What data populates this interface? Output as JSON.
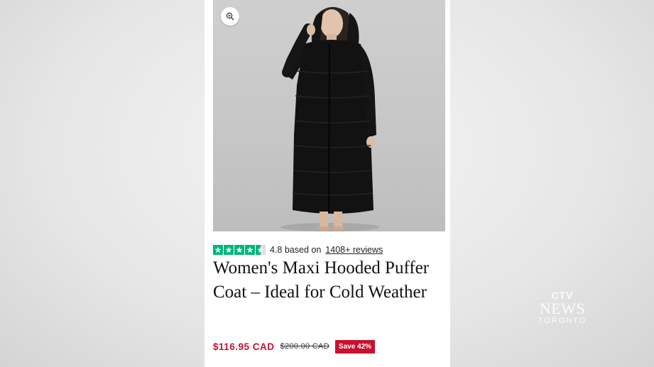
{
  "rating": {
    "score_text": "4.8 based on",
    "reviews_link": "1408+ reviews",
    "stars": 4.5
  },
  "product": {
    "title": "Women's Maxi Hooded Puffer Coat – Ideal for Cold Weather",
    "price": "$116.95 CAD",
    "original_price": "$200.00 CAD",
    "save_badge": "Save 42%"
  },
  "watermark": {
    "logo": "CTV",
    "news": "NEWS",
    "city": "TORONTO"
  },
  "colors": {
    "accent_red": "#c8102e",
    "star_green": "#00b67a"
  },
  "icons": [
    "zoom-in-icon",
    "star-icon"
  ]
}
